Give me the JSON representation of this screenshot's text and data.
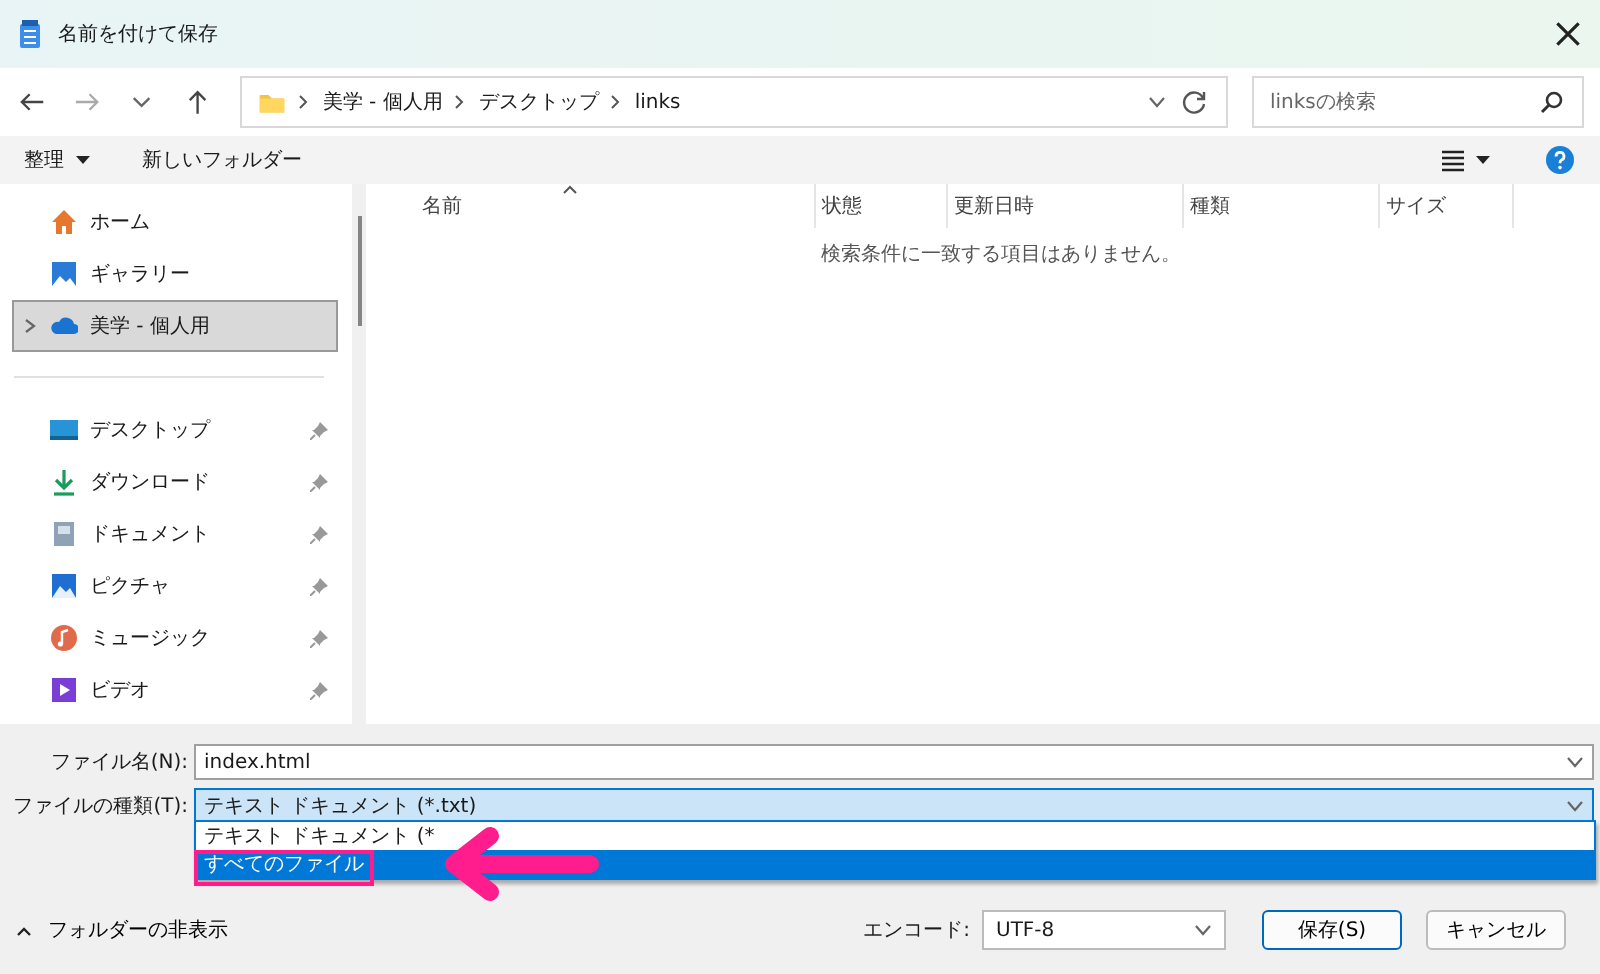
{
  "window": {
    "title": "名前を付けて保存"
  },
  "address_bar": {
    "path": [
      "美学 - 個人用",
      "デスクトップ",
      "links"
    ]
  },
  "search": {
    "placeholder": "linksの検索"
  },
  "toolbar": {
    "organize": "整理",
    "new_folder": "新しいフォルダー"
  },
  "sidebar": {
    "sections": [
      {
        "items": [
          {
            "label": "ホーム",
            "kind": "home",
            "pinned": false,
            "expandable": false,
            "selected": false
          },
          {
            "label": "ギャラリー",
            "kind": "gallery",
            "pinned": false,
            "expandable": false,
            "selected": false
          },
          {
            "label": "美学 - 個人用",
            "kind": "cloud",
            "pinned": false,
            "expandable": true,
            "selected": true
          }
        ]
      },
      {
        "items": [
          {
            "label": "デスクトップ",
            "kind": "desktop",
            "pinned": true,
            "expandable": false,
            "selected": false
          },
          {
            "label": "ダウンロード",
            "kind": "download",
            "pinned": true,
            "expandable": false,
            "selected": false
          },
          {
            "label": "ドキュメント",
            "kind": "document",
            "pinned": true,
            "expandable": false,
            "selected": false
          },
          {
            "label": "ピクチャ",
            "kind": "pictures",
            "pinned": true,
            "expandable": false,
            "selected": false
          },
          {
            "label": "ミュージック",
            "kind": "music",
            "pinned": true,
            "expandable": false,
            "selected": false
          },
          {
            "label": "ビデオ",
            "kind": "video",
            "pinned": true,
            "expandable": false,
            "selected": false
          }
        ]
      }
    ]
  },
  "table": {
    "columns": [
      {
        "label": "名前",
        "sorted": true
      },
      {
        "label": "状態",
        "sorted": false
      },
      {
        "label": "更新日時",
        "sorted": false
      },
      {
        "label": "種類",
        "sorted": false
      },
      {
        "label": "サイズ",
        "sorted": false
      }
    ],
    "empty_message": "検索条件に一致する項目はありません。"
  },
  "form": {
    "file_name": {
      "label": "ファイル名(N):",
      "value": "index.html"
    },
    "file_type": {
      "label": "ファイルの種類(T):",
      "value": "テキスト ドキュメント (*.txt)",
      "options": [
        {
          "label": "テキスト ドキュメント (*",
          "selected": false
        },
        {
          "label": "すべてのファイル",
          "selected": true
        }
      ]
    }
  },
  "footer": {
    "hide_folders": "フォルダーの非表示",
    "encoding_label": "エンコード:",
    "encoding": "UTF-8",
    "buttons": [
      {
        "label": "保存(S)",
        "kind": "primary"
      },
      {
        "label": "キャンセル",
        "kind": "secondary"
      }
    ]
  },
  "annotation": {
    "highlight_box": true,
    "arrow": true
  }
}
